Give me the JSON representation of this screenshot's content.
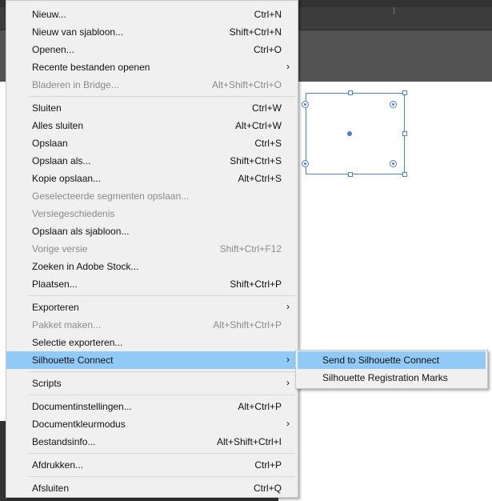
{
  "menu": {
    "items": [
      {
        "label": "Nieuw...",
        "shortcut": "Ctrl+N",
        "disabled": false,
        "submenu": false
      },
      {
        "label": "Nieuw van sjabloon...",
        "shortcut": "Shift+Ctrl+N",
        "disabled": false,
        "submenu": false
      },
      {
        "label": "Openen...",
        "shortcut": "Ctrl+O",
        "disabled": false,
        "submenu": false
      },
      {
        "label": "Recente bestanden openen",
        "shortcut": "",
        "disabled": false,
        "submenu": true
      },
      {
        "label": "Bladeren in Bridge...",
        "shortcut": "Alt+Shift+Ctrl+O",
        "disabled": true,
        "submenu": false
      },
      {
        "label": "Sluiten",
        "shortcut": "Ctrl+W",
        "disabled": false,
        "submenu": false
      },
      {
        "label": "Alles sluiten",
        "shortcut": "Alt+Ctrl+W",
        "disabled": false,
        "submenu": false
      },
      {
        "label": "Opslaan",
        "shortcut": "Ctrl+S",
        "disabled": false,
        "submenu": false
      },
      {
        "label": "Opslaan als...",
        "shortcut": "Shift+Ctrl+S",
        "disabled": false,
        "submenu": false
      },
      {
        "label": "Kopie opslaan...",
        "shortcut": "Alt+Ctrl+S",
        "disabled": false,
        "submenu": false
      },
      {
        "label": "Geselecteerde segmenten opslaan...",
        "shortcut": "",
        "disabled": true,
        "submenu": false
      },
      {
        "label": "Versiegeschiedenis",
        "shortcut": "",
        "disabled": true,
        "submenu": false
      },
      {
        "label": "Opslaan als sjabloon...",
        "shortcut": "",
        "disabled": false,
        "submenu": false
      },
      {
        "label": "Vorige versie",
        "shortcut": "Shift+Ctrl+F12",
        "disabled": true,
        "submenu": false
      },
      {
        "label": "Zoeken in Adobe Stock...",
        "shortcut": "",
        "disabled": false,
        "submenu": false
      },
      {
        "label": "Plaatsen...",
        "shortcut": "Shift+Ctrl+P",
        "disabled": false,
        "submenu": false
      },
      {
        "label": "Exporteren",
        "shortcut": "",
        "disabled": false,
        "submenu": true
      },
      {
        "label": "Pakket maken...",
        "shortcut": "Alt+Shift+Ctrl+P",
        "disabled": true,
        "submenu": false
      },
      {
        "label": "Selectie exporteren...",
        "shortcut": "",
        "disabled": false,
        "submenu": false
      },
      {
        "label": "Silhouette Connect",
        "shortcut": "",
        "disabled": false,
        "submenu": true,
        "highlighted": true
      },
      {
        "label": "Scripts",
        "shortcut": "",
        "disabled": false,
        "submenu": true
      },
      {
        "label": "Documentinstellingen...",
        "shortcut": "Alt+Ctrl+P",
        "disabled": false,
        "submenu": false
      },
      {
        "label": "Documentkleurmodus",
        "shortcut": "",
        "disabled": false,
        "submenu": true
      },
      {
        "label": "Bestandsinfo...",
        "shortcut": "Alt+Shift+Ctrl+I",
        "disabled": false,
        "submenu": false
      },
      {
        "label": "Afdrukken...",
        "shortcut": "Ctrl+P",
        "disabled": false,
        "submenu": false
      },
      {
        "label": "Afsluiten",
        "shortcut": "Ctrl+Q",
        "disabled": false,
        "submenu": false
      }
    ],
    "submenu_arrow": "›"
  },
  "submenu": {
    "items": [
      {
        "label": "Send to Silhouette Connect",
        "highlighted": true
      },
      {
        "label": "Silhouette Registration Marks",
        "highlighted": false
      }
    ]
  },
  "colors": {
    "menu_bg": "#f0f0f0",
    "highlight": "#91c9f7",
    "disabled_text": "#8a8a8a",
    "selection_blue": "#4a7fd4"
  }
}
